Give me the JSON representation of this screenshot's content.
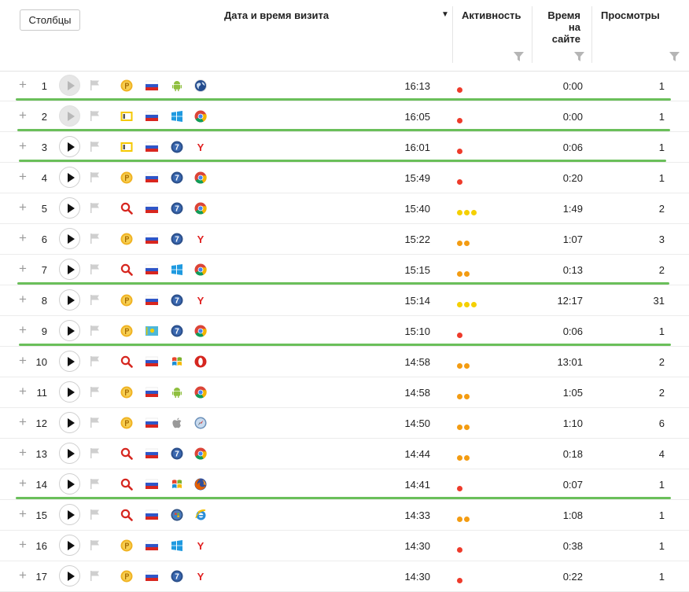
{
  "toolbar": {
    "columns_button": "Столбцы"
  },
  "headers": {
    "date": "Дата и время визита",
    "sort_arrow": "▼",
    "activity": "Активность",
    "time_lines": [
      "Время",
      "на",
      "сайте"
    ],
    "views": "Просмотры"
  },
  "colors": {
    "red": "#ee3b2b",
    "orange": "#f39c12",
    "yellow": "#f5d000",
    "green_line": "#6abf5a"
  },
  "rows": [
    {
      "num": "1",
      "time": "16:13",
      "duration": "0:00",
      "views": "1",
      "source": "direct",
      "country": "ru",
      "os": "android",
      "browser": "generic-globe",
      "activity": "red",
      "play_disabled": true
    },
    {
      "num": "2",
      "time": "16:05",
      "duration": "0:00",
      "views": "1",
      "source": "internal",
      "country": "ru",
      "os": "windows-modern",
      "browser": "chrome",
      "activity": "red",
      "play_disabled": true
    },
    {
      "num": "3",
      "time": "16:01",
      "duration": "0:06",
      "views": "1",
      "source": "internal",
      "country": "ru",
      "os": "windows-7",
      "browser": "yandex",
      "activity": "red",
      "play_disabled": false
    },
    {
      "num": "4",
      "time": "15:49",
      "duration": "0:20",
      "views": "1",
      "source": "direct",
      "country": "ru",
      "os": "windows-7",
      "browser": "chrome",
      "activity": "red",
      "play_disabled": false
    },
    {
      "num": "5",
      "time": "15:40",
      "duration": "1:49",
      "views": "2",
      "source": "search",
      "country": "ru",
      "os": "windows-7",
      "browser": "chrome",
      "activity": "yellow3",
      "play_disabled": false
    },
    {
      "num": "6",
      "time": "15:22",
      "duration": "1:07",
      "views": "3",
      "source": "direct",
      "country": "ru",
      "os": "windows-7",
      "browser": "yandex",
      "activity": "orange2",
      "play_disabled": false
    },
    {
      "num": "7",
      "time": "15:15",
      "duration": "0:13",
      "views": "2",
      "source": "search",
      "country": "ru",
      "os": "windows-modern",
      "browser": "chrome",
      "activity": "orange2",
      "play_disabled": false
    },
    {
      "num": "8",
      "time": "15:14",
      "duration": "12:17",
      "views": "31",
      "source": "direct",
      "country": "ru",
      "os": "windows-7",
      "browser": "yandex",
      "activity": "yellow3",
      "play_disabled": false
    },
    {
      "num": "9",
      "time": "15:10",
      "duration": "0:06",
      "views": "1",
      "source": "direct",
      "country": "kz",
      "os": "windows-7",
      "browser": "chrome",
      "activity": "red",
      "play_disabled": false
    },
    {
      "num": "10",
      "time": "14:58",
      "duration": "13:01",
      "views": "2",
      "source": "search",
      "country": "ru",
      "os": "windows-xp",
      "browser": "opera",
      "activity": "orange2",
      "play_disabled": false
    },
    {
      "num": "11",
      "time": "14:58",
      "duration": "1:05",
      "views": "2",
      "source": "direct",
      "country": "ru",
      "os": "android",
      "browser": "chrome",
      "activity": "orange2",
      "play_disabled": false
    },
    {
      "num": "12",
      "time": "14:50",
      "duration": "1:10",
      "views": "6",
      "source": "direct",
      "country": "ru",
      "os": "apple",
      "browser": "safari",
      "activity": "orange2",
      "play_disabled": false
    },
    {
      "num": "13",
      "time": "14:44",
      "duration": "0:18",
      "views": "4",
      "source": "search",
      "country": "ru",
      "os": "windows-7",
      "browser": "chrome",
      "activity": "orange2",
      "play_disabled": false
    },
    {
      "num": "14",
      "time": "14:41",
      "duration": "0:07",
      "views": "1",
      "source": "search",
      "country": "ru",
      "os": "windows-xp",
      "browser": "firefox",
      "activity": "red",
      "play_disabled": false
    },
    {
      "num": "15",
      "time": "14:33",
      "duration": "1:08",
      "views": "1",
      "source": "search",
      "country": "ru",
      "os": "windows-vista",
      "browser": "ie",
      "activity": "orange2",
      "play_disabled": false
    },
    {
      "num": "16",
      "time": "14:30",
      "duration": "0:38",
      "views": "1",
      "source": "direct",
      "country": "ru",
      "os": "windows-modern",
      "browser": "yandex",
      "activity": "red",
      "play_disabled": false
    },
    {
      "num": "17",
      "time": "14:30",
      "duration": "0:22",
      "views": "1",
      "source": "direct",
      "country": "ru",
      "os": "windows-7",
      "browser": "yandex",
      "activity": "red",
      "play_disabled": false
    }
  ],
  "separators_after_rows": [
    "1",
    "2",
    "3",
    "7",
    "9",
    "14"
  ]
}
